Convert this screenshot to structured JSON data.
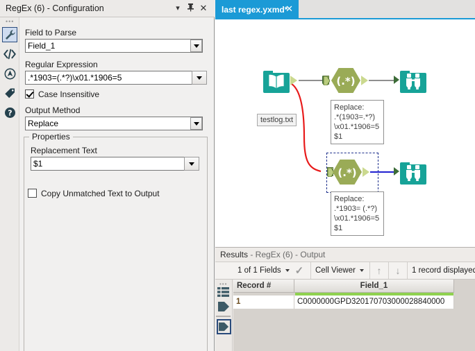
{
  "config_panel": {
    "title": "RegEx (6) - Configuration",
    "titlebar_buttons": [
      {
        "name": "menu-caret",
        "glyph": "▾"
      },
      {
        "name": "pin",
        "glyph": "⚕"
      },
      {
        "name": "close",
        "glyph": "✕"
      }
    ],
    "rail_icons": [
      {
        "name": "wrench-icon",
        "selected": true
      },
      {
        "name": "code-icon",
        "selected": false
      },
      {
        "name": "compass-icon",
        "selected": false
      },
      {
        "name": "tag-icon",
        "selected": false
      },
      {
        "name": "help-icon",
        "selected": false
      }
    ],
    "field_to_parse": {
      "label": "Field to Parse",
      "value": "Field_1"
    },
    "regular_expression": {
      "label": "Regular Expression",
      "value": ".*1903=(.*?)\\x01.*1906=5"
    },
    "case_insensitive": {
      "label": "Case Insensitive",
      "checked": true
    },
    "output_method": {
      "label": "Output Method",
      "value": "Replace"
    },
    "properties_group": {
      "legend": "Properties",
      "replacement_text": {
        "label": "Replacement Text",
        "value": "$1"
      },
      "copy_unmatched": {
        "label": "Copy Unmatched Text to Output",
        "checked": false
      }
    }
  },
  "workspace": {
    "tab": {
      "label": "last regex.yxmd*",
      "close_glyph": "✕"
    },
    "canvas": {
      "nodes": [
        {
          "name": "input-data-node",
          "icon": "open-book-icon",
          "label": "testlog.txt"
        },
        {
          "name": "regex-node-1",
          "icon": "regex-hexagon-icon",
          "label": "(.*)",
          "selected": false
        },
        {
          "name": "browse-node-1",
          "icon": "binoculars-icon",
          "label": ""
        },
        {
          "name": "regex-node-2",
          "icon": "regex-hexagon-icon",
          "label": "(.*)",
          "selected": true
        },
        {
          "name": "browse-node-2",
          "icon": "binoculars-icon",
          "label": ""
        }
      ],
      "annotation_1": "Replace:\n.*(1903=.*?)\n\\x01.*1906=5\n$1",
      "annotation_2": "Replace:\n.*1903= (.*?)\n\\x01.*1906=5\n$1",
      "hex_label": "(.*)",
      "colors": {
        "node_teal": "#17a398",
        "hex_green": "#9aab57",
        "wire_gray": "#8f8f8f",
        "wire_blue": "#2020d0",
        "wire_red": "#e81b1b",
        "selection": "#1d2f8c"
      }
    }
  },
  "results": {
    "title_main": "Results",
    "title_dim": " - RegEx (6) - Output",
    "toolbar": {
      "fields_selector": "1 of 1 Fields",
      "check_glyph": "✓",
      "view_mode": "Cell Viewer",
      "arrow_up": "↑",
      "arrow_down": "↓",
      "record_count": "1 record displayed"
    },
    "grid": {
      "columns": [
        "Record #",
        "Field_1"
      ],
      "rows": [
        {
          "record": "1",
          "field_1": "C0000000GPD320170703000028840000"
        }
      ]
    },
    "rail_icons": [
      {
        "name": "list-view-icon"
      },
      {
        "name": "input-anchor-icon"
      },
      {
        "name": "output-anchor-icon",
        "selected": true
      }
    ]
  }
}
